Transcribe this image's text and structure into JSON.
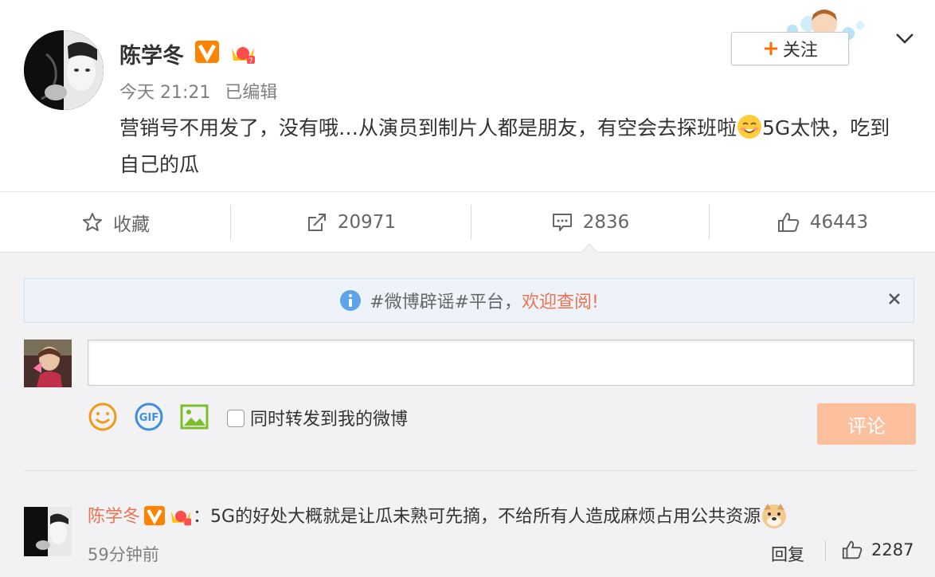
{
  "post": {
    "author": "陈学冬",
    "time": "今天 21:21",
    "edited": "已编辑",
    "content_part1": "营销号不用发了，没有哦…从演员到制片人都是朋友，有空会去探班啦",
    "content_part2": "5G太快，吃到自己的瓜",
    "follow_label": "关注",
    "follow_plus": "+",
    "icons": {
      "verified": "verified-v-badge",
      "crown": "crown-icon",
      "emoji": "smile-emoji",
      "menu": "chevron-down-icon"
    }
  },
  "actions": {
    "favorite": "收藏",
    "repost": "20971",
    "comment": "2836",
    "like": "46443"
  },
  "notice": {
    "text": "#微博辟谣#平台，",
    "link": "欢迎查阅!"
  },
  "composer": {
    "checkbox_label": "同时转发到我的微博",
    "submit_label": "评论",
    "input_placeholder": ""
  },
  "comment": {
    "author": "陈学冬",
    "colon": "：",
    "text": "5G的好处大概就是让瓜未熟可先摘，不给所有人造成麻烦占用公共资源",
    "time": "59分钟前",
    "reply_label": "回复",
    "likes": "2287"
  },
  "colors": {
    "accent": "#eb7350",
    "follow_plus": "#ff6d00",
    "submit_bg": "#fdc09e",
    "notice_bg": "#eef3fa"
  }
}
